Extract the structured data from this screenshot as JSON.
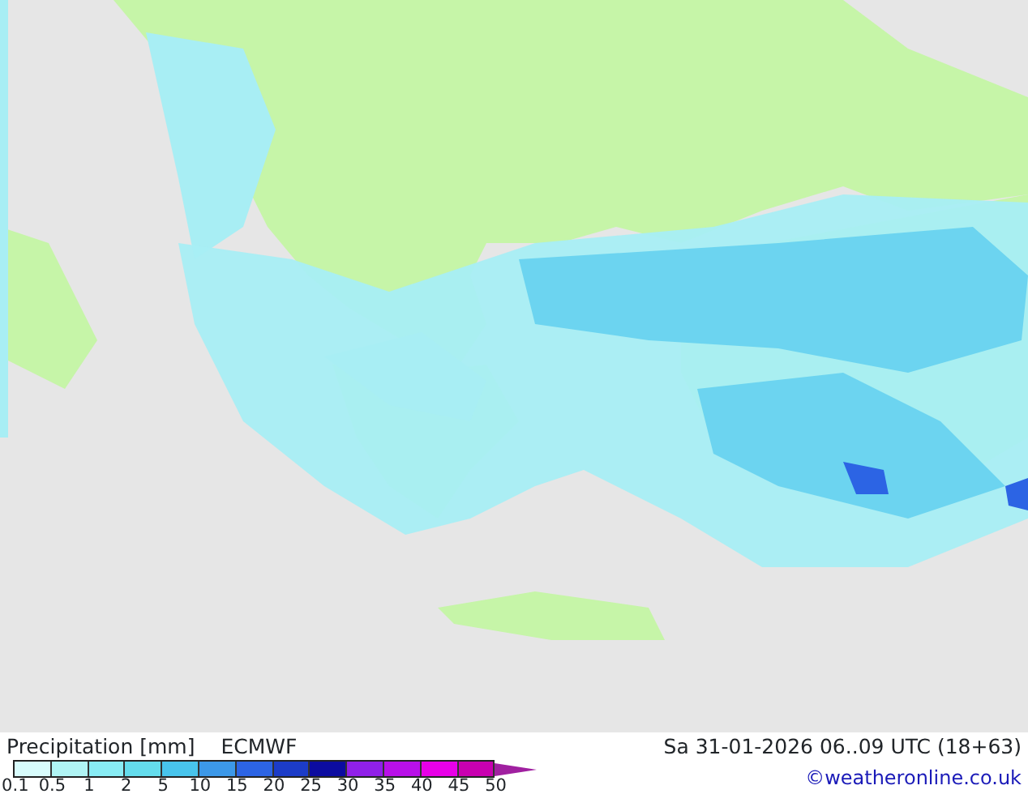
{
  "title": "Precipitation [mm]",
  "model": "ECMWF",
  "valid_time": "Sa 31-01-2026 06..09 UTC (18+63)",
  "credit": "©weatheronline.co.uk",
  "legend": [
    {
      "color": "#d8fcfc"
    },
    {
      "color": "#b0f4f4"
    },
    {
      "color": "#88ecf4"
    },
    {
      "color": "#64dcec"
    },
    {
      "color": "#48c4ec"
    },
    {
      "color": "#3c98e8"
    },
    {
      "color": "#2c64e4"
    },
    {
      "color": "#1c3cc8"
    },
    {
      "color": "#0c0ca0"
    },
    {
      "color": "#9020e8"
    },
    {
      "color": "#b810e8"
    },
    {
      "color": "#e800e8"
    },
    {
      "color": "#c800b0"
    }
  ],
  "ticks": [
    "0.1",
    "0.5",
    "1",
    "2",
    "5",
    "10",
    "15",
    "20",
    "25",
    "30",
    "35",
    "40",
    "45",
    "50"
  ]
}
